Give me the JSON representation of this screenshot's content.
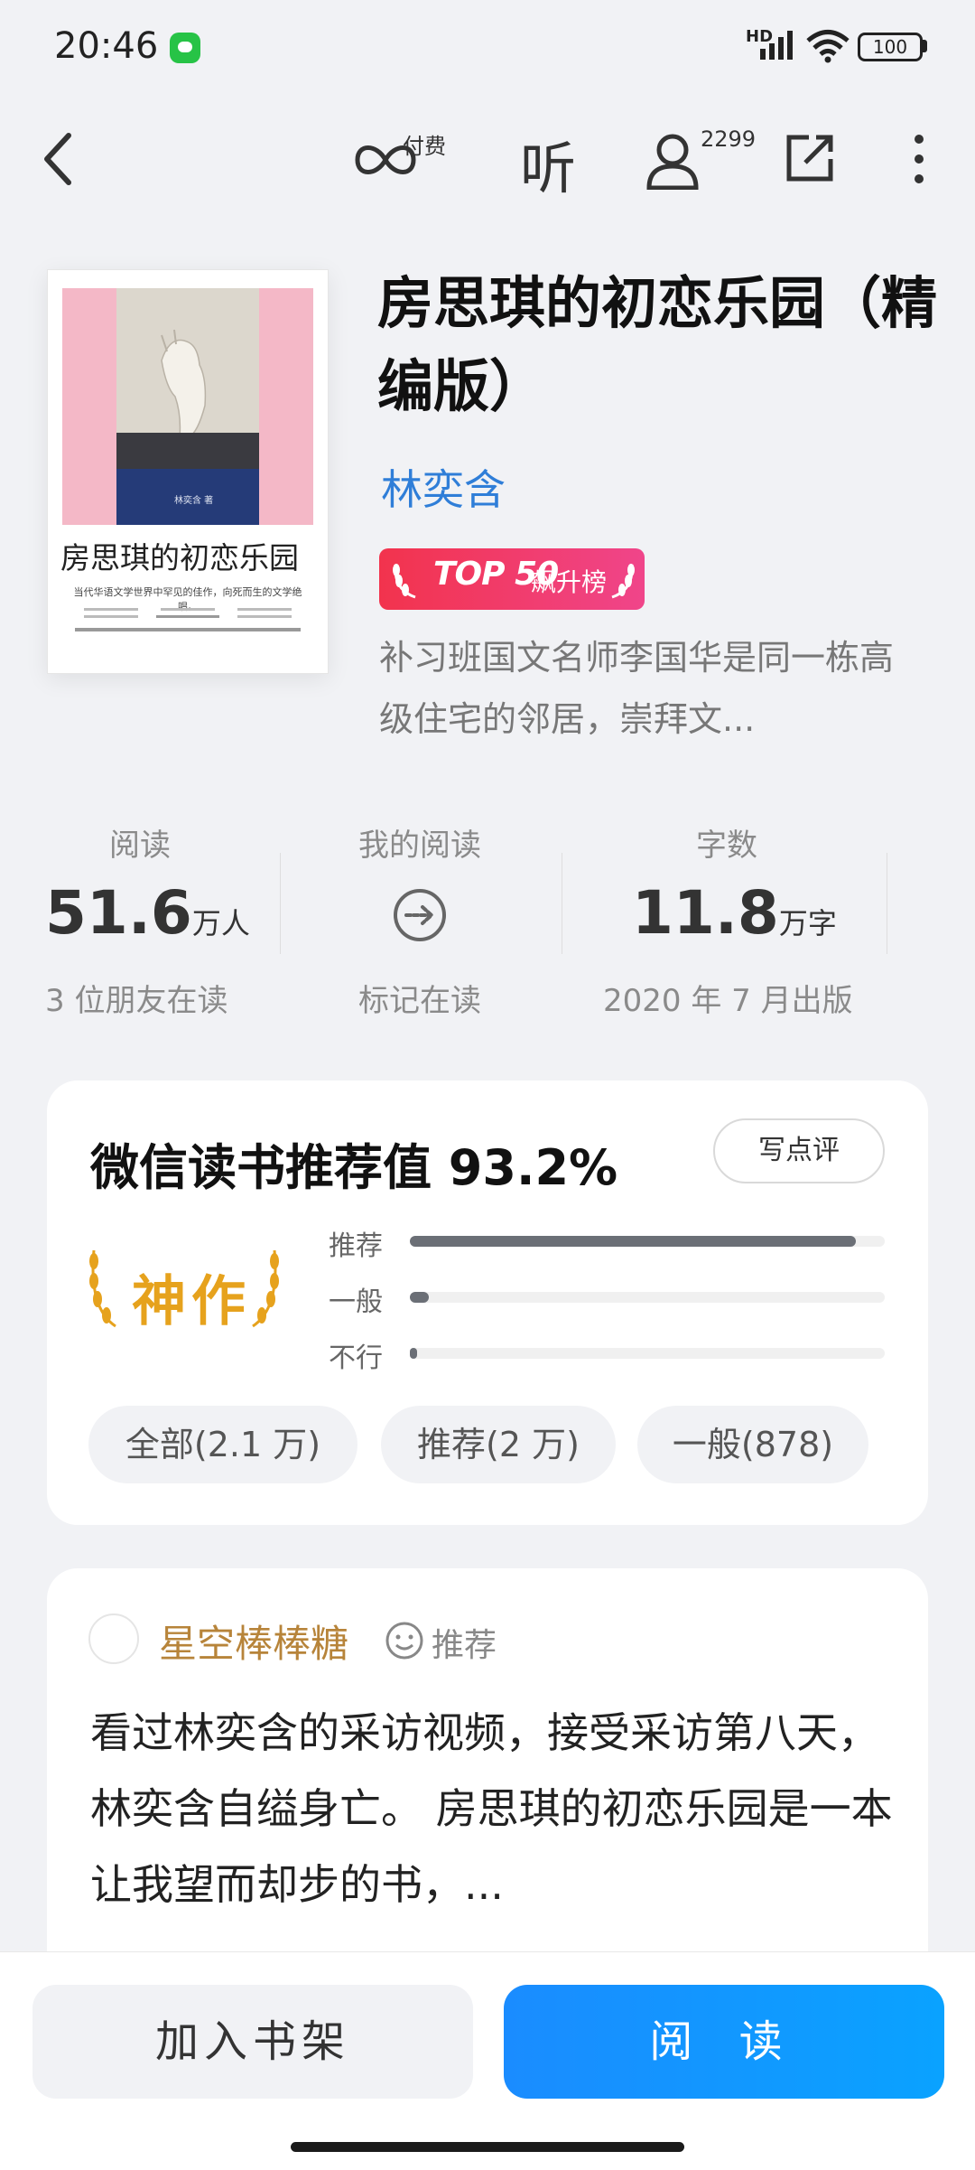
{
  "status_bar": {
    "time": "20:46",
    "network": "HD",
    "battery": "100"
  },
  "toolbar": {
    "pay_label": "付费",
    "listen_label": "听",
    "followers_count": "2299"
  },
  "book": {
    "cover_title": "房思琪的初恋乐园",
    "cover_tagline": "当代华语文学世界中罕见的佳作，向死而生的文学绝唱。",
    "cover_author": "林奕含 著",
    "title": "房思琪的初恋乐园（精编版）",
    "author": "林奕含",
    "badge_text": "TOP 50",
    "badge_rank": "飙升榜",
    "description": "补习班国文名师李国华是同一栋高级住宅的邻居，崇拜文..."
  },
  "stats": [
    {
      "label": "阅读",
      "value": "51.6",
      "unit": "万人",
      "footnote": "3 位朋友在读"
    },
    {
      "label": "我的阅读",
      "footnote": "标记在读"
    },
    {
      "label": "字数",
      "value": "11.8",
      "unit": "万字",
      "footnote": "2020 年 7 月出版"
    }
  ],
  "recommendation": {
    "title": "微信读书推荐值 93.2%",
    "write_button": "写点评",
    "badge": "神作",
    "bars": [
      {
        "label": "推荐",
        "level": 0.94
      },
      {
        "label": "一般",
        "level": 0.04
      },
      {
        "label": "不行",
        "level": 0.015
      }
    ],
    "chips": [
      "全部(2.1 万)",
      "推荐(2 万)",
      "一般(878)"
    ]
  },
  "review": {
    "user": "星空棒棒糖",
    "tag": "推荐",
    "text": "看过林奕含的采访视频，接受采访第八天，林奕含自缢身亡。 房思琪的初恋乐园是一本让我望而却步的书，..."
  },
  "bottom": {
    "add_shelf": "加入书架",
    "read": "阅 读"
  },
  "colors": {
    "accent_blue": "#1a8cff",
    "author_blue": "#2f7ed8",
    "gold": "#e6a21d",
    "badge_red": "#f2334d"
  }
}
